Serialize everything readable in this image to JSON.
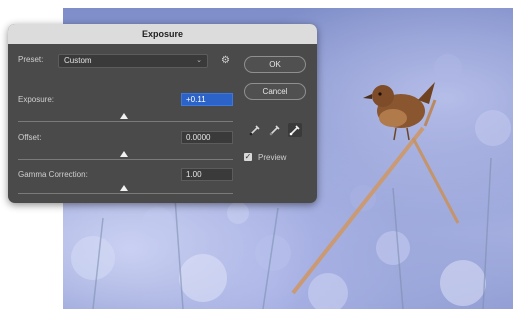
{
  "dialog": {
    "title": "Exposure",
    "preset_label": "Preset:",
    "preset_value": "Custom",
    "exposure": {
      "label": "Exposure:",
      "value": "+0.11",
      "slider_position": 0.5
    },
    "offset": {
      "label": "Offset:",
      "value": "0.0000",
      "slider_position": 0.5
    },
    "gamma": {
      "label": "Gamma Correction:",
      "value": "1.00",
      "slider_position": 0.5
    },
    "ok_label": "OK",
    "cancel_label": "Cancel",
    "preview_label": "Preview",
    "preview_checked": true,
    "icons": {
      "preset_dropdown": "chevron-down-icon",
      "settings": "gear-icon",
      "droppers": [
        "black-point-eyedropper-icon",
        "gray-point-eyedropper-icon",
        "white-point-eyedropper-icon"
      ]
    }
  },
  "colors": {
    "dialog_bg": "#4a4a4a",
    "titlebar_bg": "#dcdcdc",
    "selected_field": "#2c63c9"
  }
}
